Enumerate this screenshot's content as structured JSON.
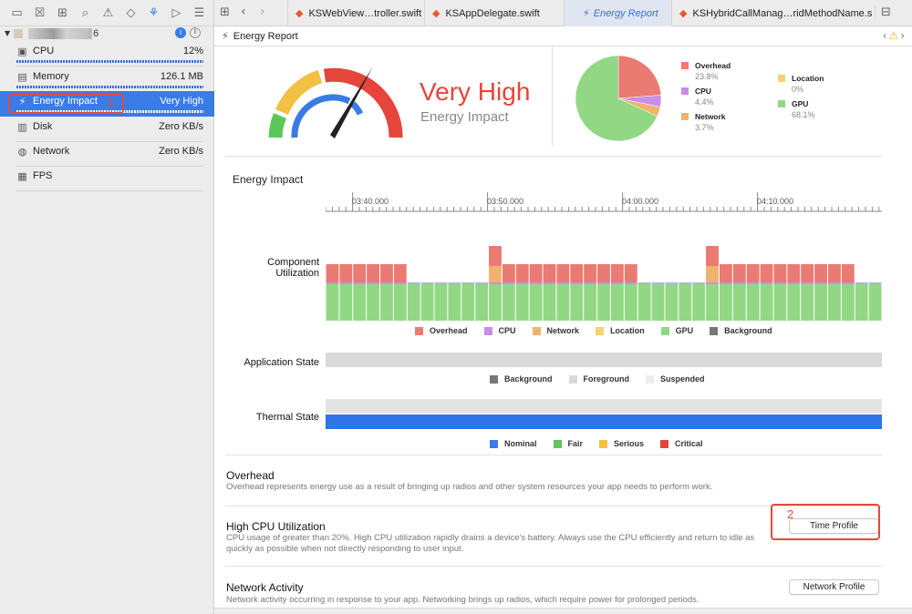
{
  "navigator": {
    "toolbar_icons": [
      "folder-icon",
      "source-control-icon",
      "hierarchy-icon",
      "search-icon",
      "warning-icon",
      "breakpoint-icon",
      "debug-icon",
      "label-icon",
      "list-icon"
    ],
    "process_name": "6",
    "rows": [
      {
        "label": "CPU",
        "value": "12%",
        "icon": "cpu-icon"
      },
      {
        "label": "Memory",
        "value": "126.1 MB",
        "icon": "memory-icon"
      },
      {
        "label": "Energy Impact",
        "value": "Very High",
        "icon": "bolt-icon"
      },
      {
        "label": "Disk",
        "value": "Zero KB/s",
        "icon": "disk-icon"
      },
      {
        "label": "Network",
        "value": "Zero KB/s",
        "icon": "network-icon"
      },
      {
        "label": "FPS",
        "value": "",
        "icon": "fps-icon"
      }
    ],
    "annotation_1": "1"
  },
  "tabs": [
    {
      "label": "KSWebView…troller.swift"
    },
    {
      "label": "KSAppDelegate.swift"
    },
    {
      "label": "Energy Report"
    },
    {
      "label": "KSHybridCallManag…ridMethodName.sw"
    }
  ],
  "editor_title": "Energy Report",
  "summary": {
    "level": "Very High",
    "caption": "Energy Impact",
    "breakdown": [
      {
        "name": "Overhead",
        "pct": "23.8%",
        "value": 23.8,
        "color": "#ea7b72"
      },
      {
        "name": "CPU",
        "pct": "4.4%",
        "value": 4.4,
        "color": "#c98ee8"
      },
      {
        "name": "Network",
        "pct": "3.7%",
        "value": 3.7,
        "color": "#f0b36f"
      },
      {
        "name": "Location",
        "pct": "0%",
        "value": 0,
        "color": "#f5d46b"
      },
      {
        "name": "GPU",
        "pct": "68.1%",
        "value": 68.1,
        "color": "#92d884"
      }
    ]
  },
  "timeline": {
    "title": "Energy Impact",
    "ticks": [
      "03:40.000",
      "03:50.000",
      "04:00.000",
      "04:10.000"
    ],
    "component_label_1": "Component",
    "component_label_2": "Utilization",
    "component_legend": [
      {
        "name": "Overhead",
        "color": "#ea7b72"
      },
      {
        "name": "CPU",
        "color": "#c98ee8"
      },
      {
        "name": "Network",
        "color": "#f0b36f"
      },
      {
        "name": "Location",
        "color": "#f5d46b"
      },
      {
        "name": "GPU",
        "color": "#92d884"
      },
      {
        "name": "Background",
        "color": "#777777"
      }
    ],
    "app_state_label": "Application State",
    "app_state_legend": [
      {
        "name": "Background",
        "color": "#777777"
      },
      {
        "name": "Foreground",
        "color": "#d9d9d9"
      },
      {
        "name": "Suspended",
        "color": "#ececec"
      }
    ],
    "thermal_label": "Thermal State",
    "thermal_legend": [
      {
        "name": "Nominal",
        "color": "#3b7be5"
      },
      {
        "name": "Fair",
        "color": "#5cc75a"
      },
      {
        "name": "Serious",
        "color": "#f2c144"
      },
      {
        "name": "Critical",
        "color": "#e5453b"
      }
    ]
  },
  "sections": [
    {
      "title": "Overhead",
      "desc": "Overhead represents energy use as a result of bringing up radios and other system resources your app needs to perform work.",
      "button": ""
    },
    {
      "title": "High CPU Utilization",
      "desc": "CPU usage of greater than 20%. High CPU utilization rapidly drains a device's battery. Always use the CPU efficiently and return to idle as quickly as possible when not directly responding to user input.",
      "button": "Time Profile"
    },
    {
      "title": "Network Activity",
      "desc": "Network activity occurring in response to your app. Networking brings up radios, which require power for prolonged periods.",
      "button": "Network Profile"
    }
  ],
  "annotation_2": "2",
  "chart_data": {
    "type": "pie",
    "categories": [
      "Overhead",
      "CPU",
      "Network",
      "Location",
      "GPU"
    ],
    "values": [
      23.8,
      4.4,
      3.7,
      0,
      68.1
    ]
  }
}
